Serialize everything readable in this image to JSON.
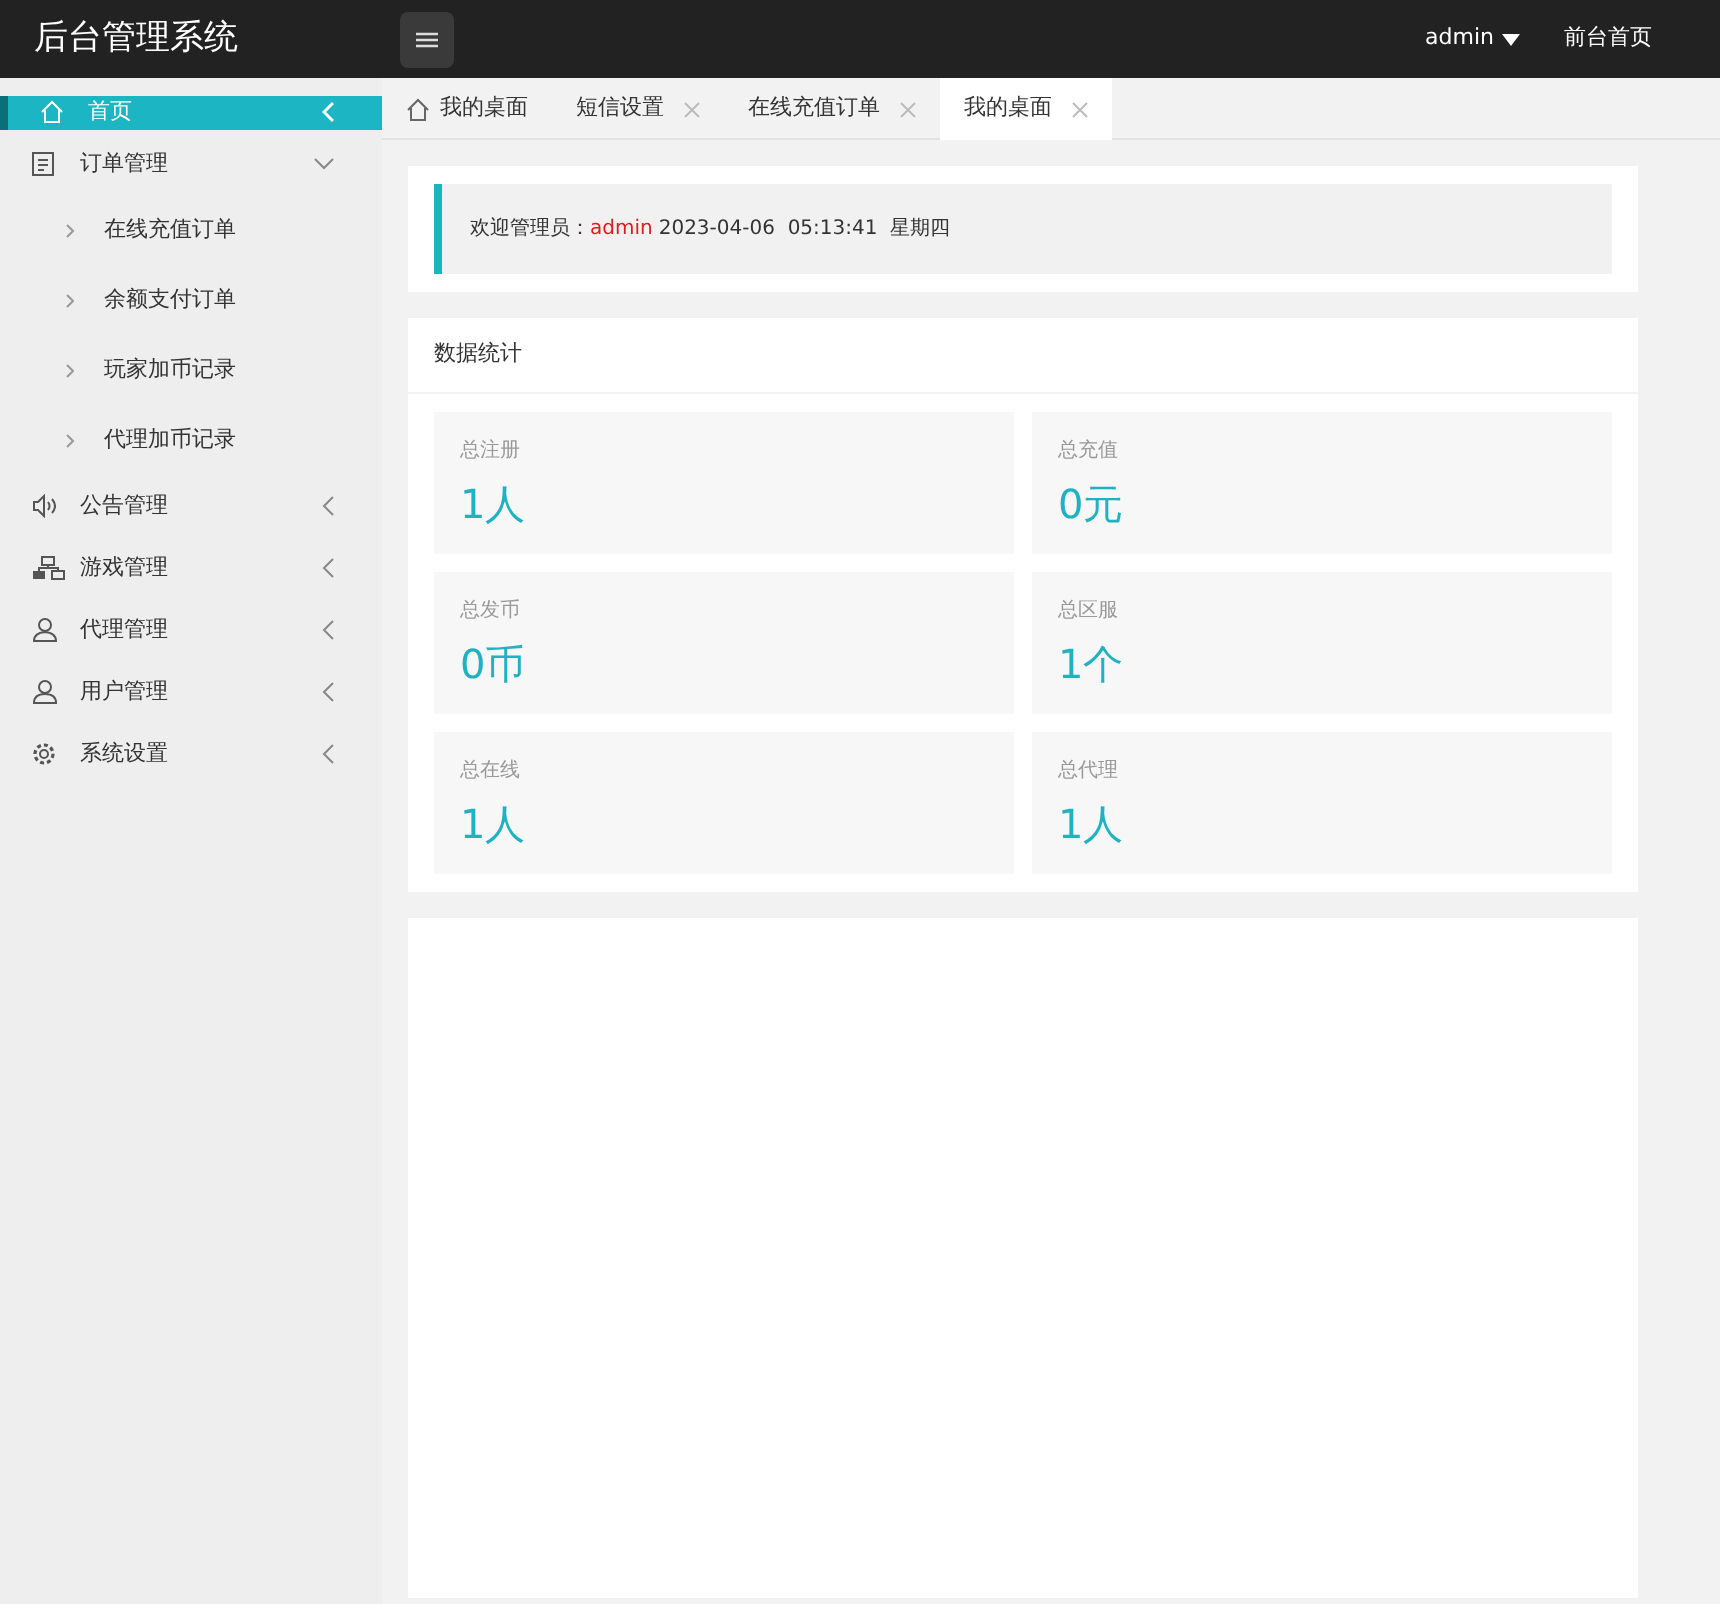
{
  "header": {
    "title": "后台管理系统",
    "user": "admin",
    "home_link": "前台首页"
  },
  "sidebar": {
    "items": [
      {
        "label": "首页",
        "selected": true,
        "expanded": false
      },
      {
        "label": "订单管理",
        "selected": false,
        "expanded": true,
        "children": [
          {
            "label": "在线充值订单",
            "selected": false
          },
          {
            "label": "余额支付订单",
            "selected": false
          },
          {
            "label": "玩家加币记录",
            "selected": false
          },
          {
            "label": "代理加币记录",
            "selected": false
          }
        ]
      },
      {
        "label": "公告管理",
        "selected": false,
        "expanded": false
      },
      {
        "label": "游戏管理",
        "selected": false,
        "expanded": false
      },
      {
        "label": "代理管理",
        "selected": false,
        "expanded": false
      },
      {
        "label": "用户管理",
        "selected": false,
        "expanded": false
      },
      {
        "label": "系统设置",
        "selected": false,
        "expanded": false
      }
    ]
  },
  "tabs": [
    {
      "label": "我的桌面",
      "selected": false,
      "closable": false
    },
    {
      "label": "短信设置",
      "selected": false,
      "closable": true
    },
    {
      "label": "在线充值订单",
      "selected": false,
      "closable": true
    },
    {
      "label": "我的桌面",
      "selected": true,
      "closable": true
    }
  ],
  "welcome": {
    "greeting": "欢迎管理员：",
    "user": "admin",
    "datetime": "2023-04-06  05:13:41  星期四"
  },
  "stats": {
    "title": "数据统计",
    "cards": [
      {
        "label": "总注册",
        "value": "1人"
      },
      {
        "label": "总充值",
        "value": "0元"
      },
      {
        "label": "总发币",
        "value": "0币"
      },
      {
        "label": "总区服",
        "value": "1个"
      },
      {
        "label": "总在线",
        "value": "1人"
      },
      {
        "label": "总代理",
        "value": "1人"
      }
    ]
  }
}
